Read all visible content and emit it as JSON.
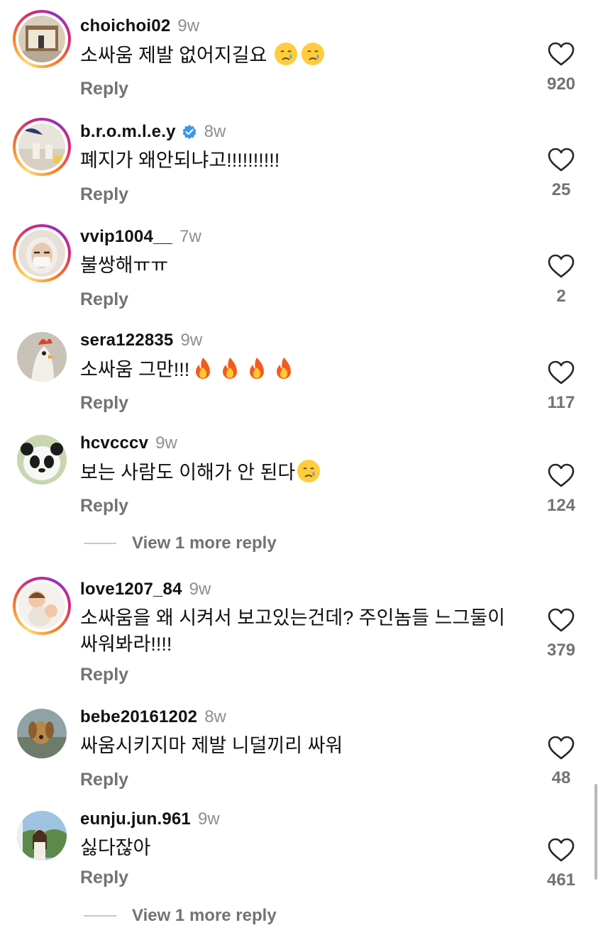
{
  "comments": [
    {
      "username": "choichoi02",
      "verified": false,
      "time": "9w",
      "text": "소싸움 제발 없어지길요",
      "emojis": [
        "crying-face",
        "crying-face"
      ],
      "likes": "920",
      "reply": "Reply",
      "ring": true
    },
    {
      "username": "b.r.o.m.l.e.y",
      "verified": true,
      "time": "8w",
      "text": "폐지가 왜안되냐고!!!!!!!!!!",
      "emojis": [],
      "likes": "25",
      "reply": "Reply",
      "ring": true
    },
    {
      "username": "vvip1004__",
      "verified": false,
      "time": "7w",
      "text": "불쌍해ㅠㅠ",
      "emojis": [],
      "likes": "2",
      "reply": "Reply",
      "ring": true
    },
    {
      "username": "sera122835",
      "verified": false,
      "time": "9w",
      "text": "소싸움 그만!!!",
      "emojis": [
        "fire",
        "fire",
        "fire",
        "fire"
      ],
      "likes": "117",
      "reply": "Reply",
      "ring": false
    },
    {
      "username": "hcvcccv",
      "verified": false,
      "time": "9w",
      "text": "보는 사람도 이해가 안 된다",
      "emojis": [
        "crying-face"
      ],
      "likes": "124",
      "reply": "Reply",
      "ring": false,
      "more_replies": "View 1 more reply"
    },
    {
      "username": "love1207_84",
      "verified": false,
      "time": "9w",
      "text": "소싸움을 왜 시켜서 보고있는건데? 주인놈들 느그둘이 싸워봐라!!!!",
      "emojis": [],
      "likes": "379",
      "reply": "Reply",
      "ring": true
    },
    {
      "username": "bebe20161202",
      "verified": false,
      "time": "8w",
      "text": "싸움시키지마 제발 니덜끼리 싸워",
      "emojis": [],
      "likes": "48",
      "reply": "Reply",
      "ring": false
    },
    {
      "username": "eunju.jun.961",
      "verified": false,
      "time": "9w",
      "text": "싫다잖아",
      "emojis": [],
      "likes": "461",
      "reply": "Reply",
      "ring": false,
      "more_replies": "View 1 more reply"
    }
  ],
  "colors": {
    "text": "#111111",
    "muted": "#737373",
    "time": "#8e8e8e",
    "verified": "#3897f0"
  }
}
